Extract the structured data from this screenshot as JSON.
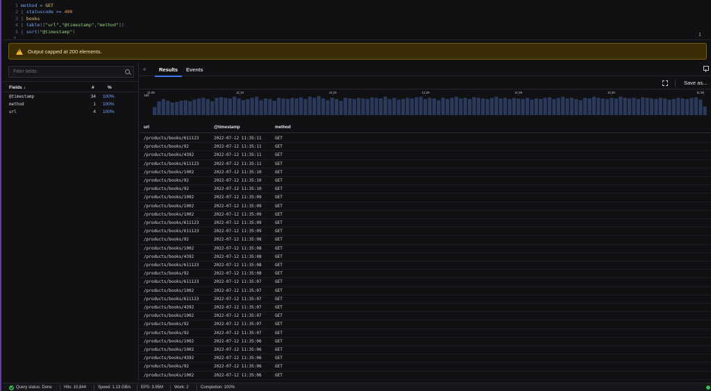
{
  "query": {
    "line_numbers": [
      "1",
      "2",
      "3",
      "4",
      "5"
    ],
    "lines": [
      {
        "parts": [
          {
            "t": "method = ",
            "c": "kw"
          },
          {
            "t": "GET",
            "c": "fn"
          }
        ]
      },
      {
        "parts": [
          {
            "t": "| ",
            "c": "pipe"
          },
          {
            "t": "statuscode >= ",
            "c": "kw"
          },
          {
            "t": "400",
            "c": "num"
          }
        ]
      },
      {
        "parts": [
          {
            "t": "| ",
            "c": "pipe"
          },
          {
            "t": "books",
            "c": "fn"
          }
        ]
      },
      {
        "parts": [
          {
            "t": "| ",
            "c": "pipe"
          },
          {
            "t": "table",
            "c": "kw"
          },
          {
            "t": "([",
            "c": "pipe"
          },
          {
            "t": "\"url\",\"@timestamp\",\"method\"",
            "c": "str"
          },
          {
            "t": "])",
            "c": "pipe"
          }
        ]
      },
      {
        "parts": [
          {
            "t": "| ",
            "c": "pipe"
          },
          {
            "t": "sort",
            "c": "kw"
          },
          {
            "t": "(",
            "c": "pipe"
          },
          {
            "t": "\"@timestamp\"",
            "c": "str"
          },
          {
            "t": ")",
            "c": "pipe"
          }
        ]
      }
    ]
  },
  "warning": {
    "text": "Output capped at 200 elements."
  },
  "fields_panel": {
    "filter_placeholder": "Filter fields",
    "headers": {
      "name": "Fields ↓",
      "count": "#",
      "pct": "%"
    },
    "fields": [
      {
        "name": "@timestamp",
        "count": "34",
        "pct": "100%"
      },
      {
        "name": "method",
        "count": "1",
        "pct": "100%"
      },
      {
        "name": "url",
        "count": "4",
        "pct": "100%"
      }
    ]
  },
  "tabs": [
    {
      "label": "Results",
      "active": true
    },
    {
      "label": "Events",
      "active": false
    }
  ],
  "toolbar": {
    "save_label": "Save as..."
  },
  "chart_data": {
    "type": "bar",
    "x_ticks": [
      "11:05",
      "11:10",
      "11:15",
      "11:20",
      "11:25",
      "11:30",
      "11:35"
    ],
    "y_tick": "163",
    "values": [
      70,
      120,
      140,
      125,
      110,
      115,
      125,
      130,
      120,
      135,
      145,
      150,
      140,
      120,
      150,
      155,
      150,
      145,
      160,
      145,
      130,
      140,
      150,
      160,
      130,
      145,
      140,
      125,
      150,
      145,
      140,
      150,
      145,
      155,
      140,
      160,
      150,
      165,
      145,
      130,
      150,
      140,
      125,
      150,
      145,
      140,
      150,
      145,
      140,
      155,
      150,
      145,
      160,
      140,
      150,
      135,
      140,
      150,
      145,
      155,
      160,
      140,
      150,
      145,
      130,
      150,
      140,
      150,
      160,
      145,
      150,
      140,
      155,
      150,
      145,
      140,
      150,
      160,
      145,
      150,
      140,
      150,
      145,
      140,
      150,
      135,
      145,
      140,
      150,
      155,
      140,
      150,
      160,
      145,
      150,
      140,
      130,
      150,
      145,
      160,
      150,
      145,
      140,
      150,
      145,
      160,
      150,
      145,
      150,
      140,
      155,
      150,
      145,
      140,
      150,
      145,
      135,
      140,
      150,
      145,
      140,
      150,
      155,
      135,
      75
    ],
    "ymax": 163
  },
  "table": {
    "columns": {
      "url": "url",
      "timestamp": "@timestamp",
      "method": "method"
    },
    "rows": [
      {
        "url": "/products/books/611123",
        "ts": "2022-07-12 11:35:11",
        "m": "GET"
      },
      {
        "url": "/products/books/92",
        "ts": "2022-07-12 11:35:11",
        "m": "GET"
      },
      {
        "url": "/products/books/4392",
        "ts": "2022-07-12 11:35:11",
        "m": "GET"
      },
      {
        "url": "/products/books/611123",
        "ts": "2022-07-12 11:35:11",
        "m": "GET"
      },
      {
        "url": "/products/books/1002",
        "ts": "2022-07-12 11:35:10",
        "m": "GET"
      },
      {
        "url": "/products/books/92",
        "ts": "2022-07-12 11:35:10",
        "m": "GET"
      },
      {
        "url": "/products/books/92",
        "ts": "2022-07-12 11:35:10",
        "m": "GET"
      },
      {
        "url": "/products/books/1002",
        "ts": "2022-07-12 11:35:09",
        "m": "GET"
      },
      {
        "url": "/products/books/1002",
        "ts": "2022-07-12 11:35:09",
        "m": "GET"
      },
      {
        "url": "/products/books/1002",
        "ts": "2022-07-12 11:35:09",
        "m": "GET"
      },
      {
        "url": "/products/books/611123",
        "ts": "2022-07-12 11:35:09",
        "m": "GET"
      },
      {
        "url": "/products/books/611123",
        "ts": "2022-07-12 11:35:09",
        "m": "GET"
      },
      {
        "url": "/products/books/92",
        "ts": "2022-07-12 11:35:08",
        "m": "GET"
      },
      {
        "url": "/products/books/1002",
        "ts": "2022-07-12 11:35:08",
        "m": "GET"
      },
      {
        "url": "/products/books/4392",
        "ts": "2022-07-12 11:35:08",
        "m": "GET"
      },
      {
        "url": "/products/books/611123",
        "ts": "2022-07-12 11:35:08",
        "m": "GET"
      },
      {
        "url": "/products/books/92",
        "ts": "2022-07-12 11:35:08",
        "m": "GET"
      },
      {
        "url": "/products/books/611123",
        "ts": "2022-07-12 11:35:07",
        "m": "GET"
      },
      {
        "url": "/products/books/1002",
        "ts": "2022-07-12 11:35:07",
        "m": "GET"
      },
      {
        "url": "/products/books/611123",
        "ts": "2022-07-12 11:35:07",
        "m": "GET"
      },
      {
        "url": "/products/books/4392",
        "ts": "2022-07-12 11:35:07",
        "m": "GET"
      },
      {
        "url": "/products/books/1002",
        "ts": "2022-07-12 11:35:07",
        "m": "GET"
      },
      {
        "url": "/products/books/92",
        "ts": "2022-07-12 11:35:07",
        "m": "GET"
      },
      {
        "url": "/products/books/92",
        "ts": "2022-07-12 11:35:07",
        "m": "GET"
      },
      {
        "url": "/products/books/1002",
        "ts": "2022-07-12 11:35:06",
        "m": "GET"
      },
      {
        "url": "/products/books/1002",
        "ts": "2022-07-12 11:35:06",
        "m": "GET"
      },
      {
        "url": "/products/books/4392",
        "ts": "2022-07-12 11:35:06",
        "m": "GET"
      },
      {
        "url": "/products/books/92",
        "ts": "2022-07-12 11:35:06",
        "m": "GET"
      },
      {
        "url": "/products/books/1002",
        "ts": "2022-07-12 11:35:06",
        "m": "GET"
      }
    ]
  },
  "status": {
    "query_status": "Query status: Done",
    "hits": "Hits: 10,844",
    "speed": "Speed: 1.13 GB/s",
    "eps": "EPS: 3.95M",
    "work": "Work: 2",
    "completion": "Completion: 100%"
  },
  "colors": {
    "accent": "#3d7cf4",
    "bar": "#2a3a5c",
    "warning_bg": "#3b2d06",
    "ok": "#3fb950"
  }
}
